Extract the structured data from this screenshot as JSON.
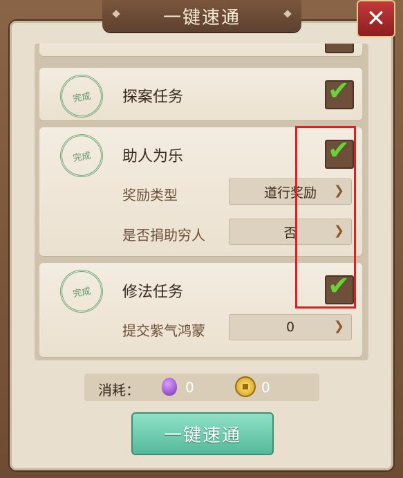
{
  "window": {
    "title": "一键速通"
  },
  "tasks": [
    {
      "title": "探案任务",
      "stamp": "完成",
      "checked": true
    },
    {
      "title": "助人为乐",
      "stamp": "完成",
      "checked": true,
      "options": [
        {
          "label": "奖励类型",
          "value": "道行奖励"
        },
        {
          "label": "是否捐助穷人",
          "value": "否"
        }
      ]
    },
    {
      "title": "修法任务",
      "stamp": "完成",
      "checked": true,
      "options": [
        {
          "label": "提交紫气鸿蒙",
          "value": "0"
        }
      ]
    }
  ],
  "cost": {
    "label": "消耗：",
    "gem_value": "0",
    "coin_value": "0"
  },
  "buttons": {
    "main": "一键速通",
    "close_icon": "close-icon"
  },
  "colors": {
    "highlight": "#e02020",
    "accent": "#54b99a"
  }
}
